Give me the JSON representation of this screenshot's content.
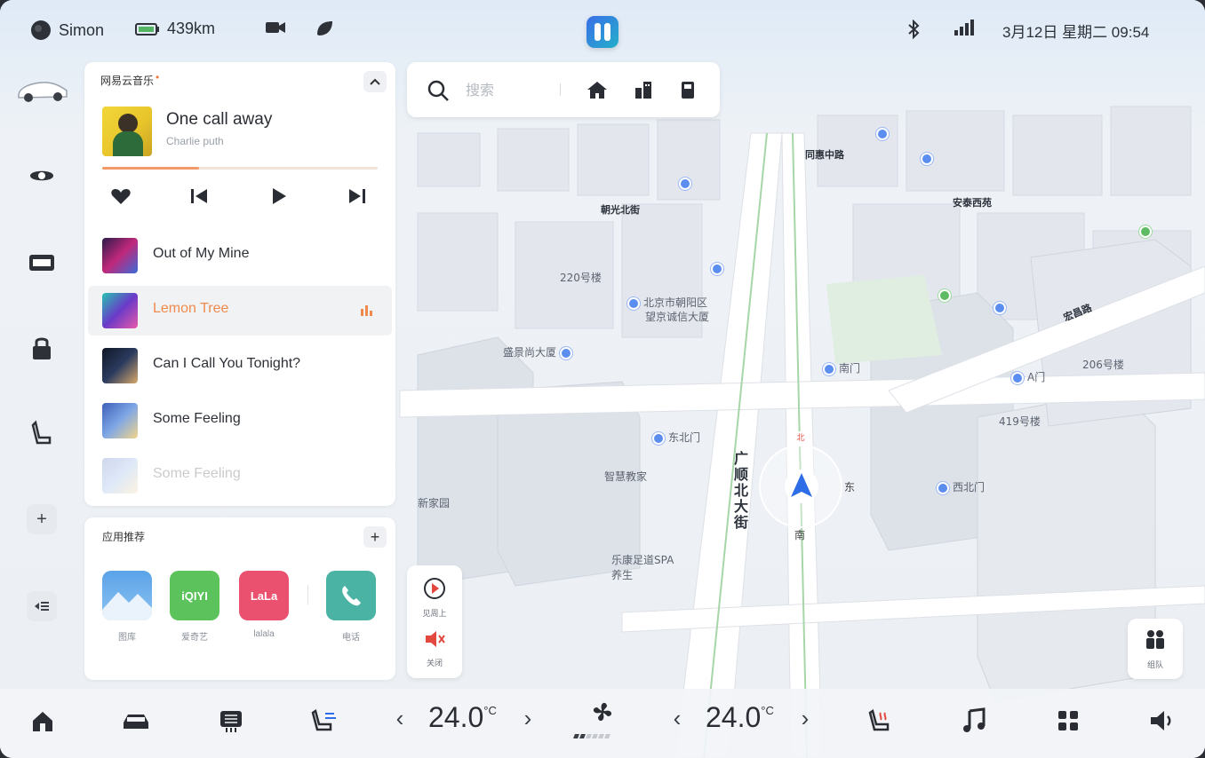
{
  "status_bar": {
    "user_name": "Simon",
    "range": "439km",
    "datetime": "3月12日 星期二 09:54"
  },
  "music": {
    "app_name": "网易云音乐",
    "now_playing": {
      "title": "One call away",
      "artist": "Charlie puth",
      "progress": 0.35
    },
    "controls": [
      "like",
      "previous",
      "play",
      "next"
    ],
    "playlist": [
      {
        "title": "Out of My Mine",
        "active": false
      },
      {
        "title": "Lemon Tree",
        "active": true
      },
      {
        "title": "Can I Call You Tonight?",
        "active": false
      },
      {
        "title": "Some Feeling",
        "active": false
      },
      {
        "title": "Some Feeling",
        "active": false
      }
    ]
  },
  "apps": {
    "title": "应用推荐",
    "items": [
      {
        "label": "图库",
        "tile_text": ""
      },
      {
        "label": "爱奇艺",
        "tile_text": "iQIYI"
      },
      {
        "label": "lalala",
        "tile_text": "LaLa"
      },
      {
        "label": "电话",
        "tile_text": ""
      }
    ]
  },
  "search": {
    "placeholder": "搜索"
  },
  "map_tools": {
    "tool1": "见周上",
    "tool2": "关闭"
  },
  "team": {
    "label": "组队"
  },
  "compass": {
    "north": "北",
    "east": "东",
    "south": "南"
  },
  "map_labels": {
    "l1": "同惠中路",
    "l2": "朝光北街",
    "l3": "安泰西苑",
    "l4": "北京市朝阳区",
    "l5": "望京诚信大厦",
    "l6": "盛景尚大厦",
    "l7": "东北门",
    "l8": "智慧教家",
    "l9": "广顺北大街",
    "l10": "乐康足道SPA养生",
    "l11": "西北门",
    "l12": "宏昌路",
    "l13": "A门",
    "l14": "419号楼",
    "l15": "220号楼",
    "l16": "206号楼",
    "l17": "南门",
    "l18": "新家园"
  },
  "climate": {
    "left_temp": "24.0",
    "right_temp": "24.0",
    "unit": "°C",
    "fan_level": 2,
    "fan_max": 6
  },
  "colors": {
    "accent": "#f08a4c",
    "map_road": "#ffffff",
    "map_building": "#e2e6ec",
    "nav_arrow": "#2f6ce8"
  }
}
